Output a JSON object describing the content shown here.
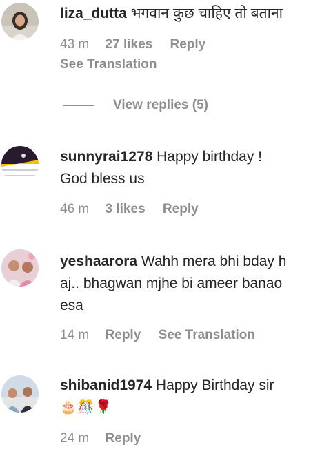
{
  "comments": [
    {
      "username": "liza_dutta",
      "text": "भगवान कुछ चाहिए तो बताना",
      "time": "43 m",
      "likes": "27 likes",
      "reply": "Reply",
      "translation": "See Translation",
      "view_replies": "View replies (5)"
    },
    {
      "username": "sunnyrai1278",
      "text_line1": "Happy birthday !",
      "text_line2": "God bless us",
      "time": "46 m",
      "likes": "3 likes",
      "reply": "Reply"
    },
    {
      "username": "yeshaarora",
      "text_line1": "Wahh mera bhi bday h",
      "text_line2": "aj.. bhagwan mjhe bi ameer banao",
      "text_line3": "esa",
      "time": "14 m",
      "reply": "Reply",
      "translation": "See Translation"
    },
    {
      "username": "shibanid1974",
      "text_line1": "Happy Birthday sir",
      "emojis": "🎂🎊🌹",
      "time": "24 m",
      "reply": "Reply"
    }
  ],
  "colors": {
    "text": "#262626",
    "muted": "#8e8e8e",
    "background": "#ffffff"
  }
}
